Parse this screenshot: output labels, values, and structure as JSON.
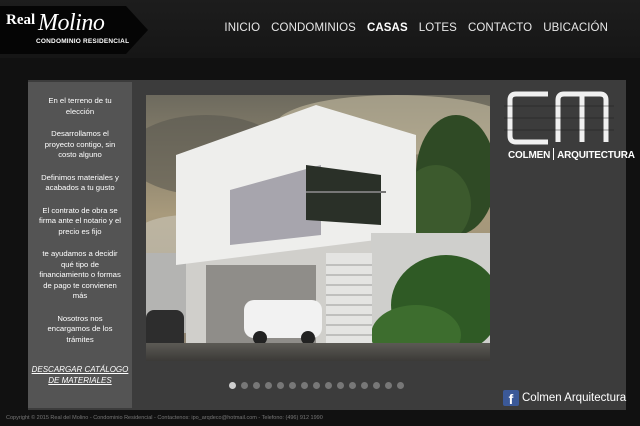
{
  "logo": {
    "real": "Real",
    "molino": "Molino",
    "subtitle": "CONDOMINIO RESIDENCIAL"
  },
  "nav": [
    "INICIO",
    "CONDOMINIOS",
    "CASAS",
    "LOTES",
    "CONTACTO",
    "UBICACIÓN"
  ],
  "nav_active": "CASAS",
  "sidebar": {
    "items": [
      "En el terreno de tu elección",
      "Desarrollamos el proyecto contigo, sin costo alguno",
      "Definimos materiales y acabados a tu gusto",
      "El contrato de obra se firma ante el notario y el precio es fijo",
      "te ayudamos a decidir qué tipo de financiamiento o formas de pago te convienen más",
      "Nosotros nos encargamos de los trámites"
    ],
    "download": "DESCARGAR CATÁLOGO DE MATERIALES"
  },
  "slider": {
    "total_slides": 15,
    "active_index": 0
  },
  "brand": {
    "logo_letters": "CM",
    "name_left": "COLMEN",
    "name_right": "ARQUITECTURA"
  },
  "facebook": {
    "icon": "facebook-icon",
    "label": "Colmen Arquitectura"
  },
  "footer": "Copyright © 2015 Real del Molino - Condominio Residencial - Contactenos: ipo_arqdeco@hotmail.com - Telefono: (496) 912 1990",
  "colors": {
    "background": "#111111",
    "panel": "#3c3c3c",
    "sidebar": "#545454",
    "facebook": "#3b5998"
  }
}
